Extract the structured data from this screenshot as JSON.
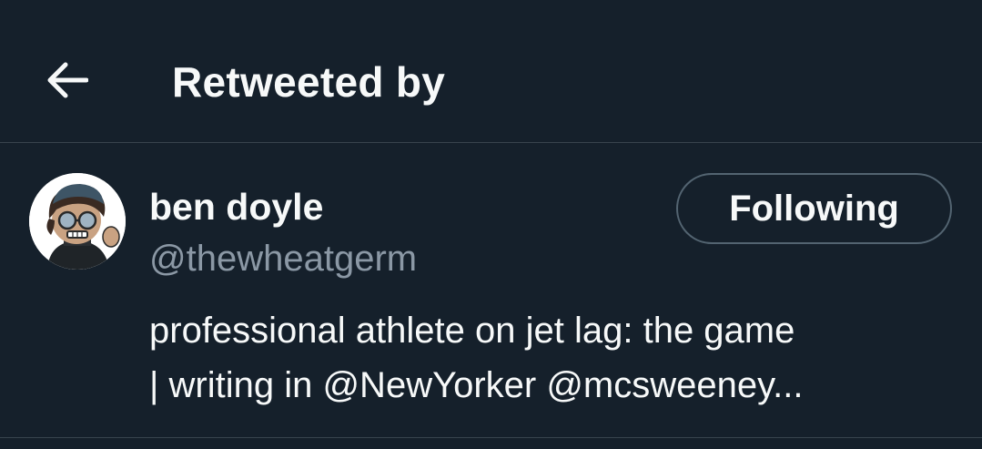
{
  "header": {
    "back_icon": "arrow-left-icon",
    "title": "Retweeted by"
  },
  "user": {
    "avatar_icon": "cartoon-avatar",
    "display_name": "ben doyle",
    "handle": "@thewheatgerm",
    "follow_button_label": "Following",
    "bio_lines": [
      "professional athlete on jet lag: the game",
      "| writing in @NewYorker @mcsweeney..."
    ]
  },
  "colors": {
    "background": "#15202b",
    "divider": "#38444d",
    "primary_text": "#f7f9f9",
    "secondary_text": "#8b98a5",
    "button_border": "#536471"
  }
}
